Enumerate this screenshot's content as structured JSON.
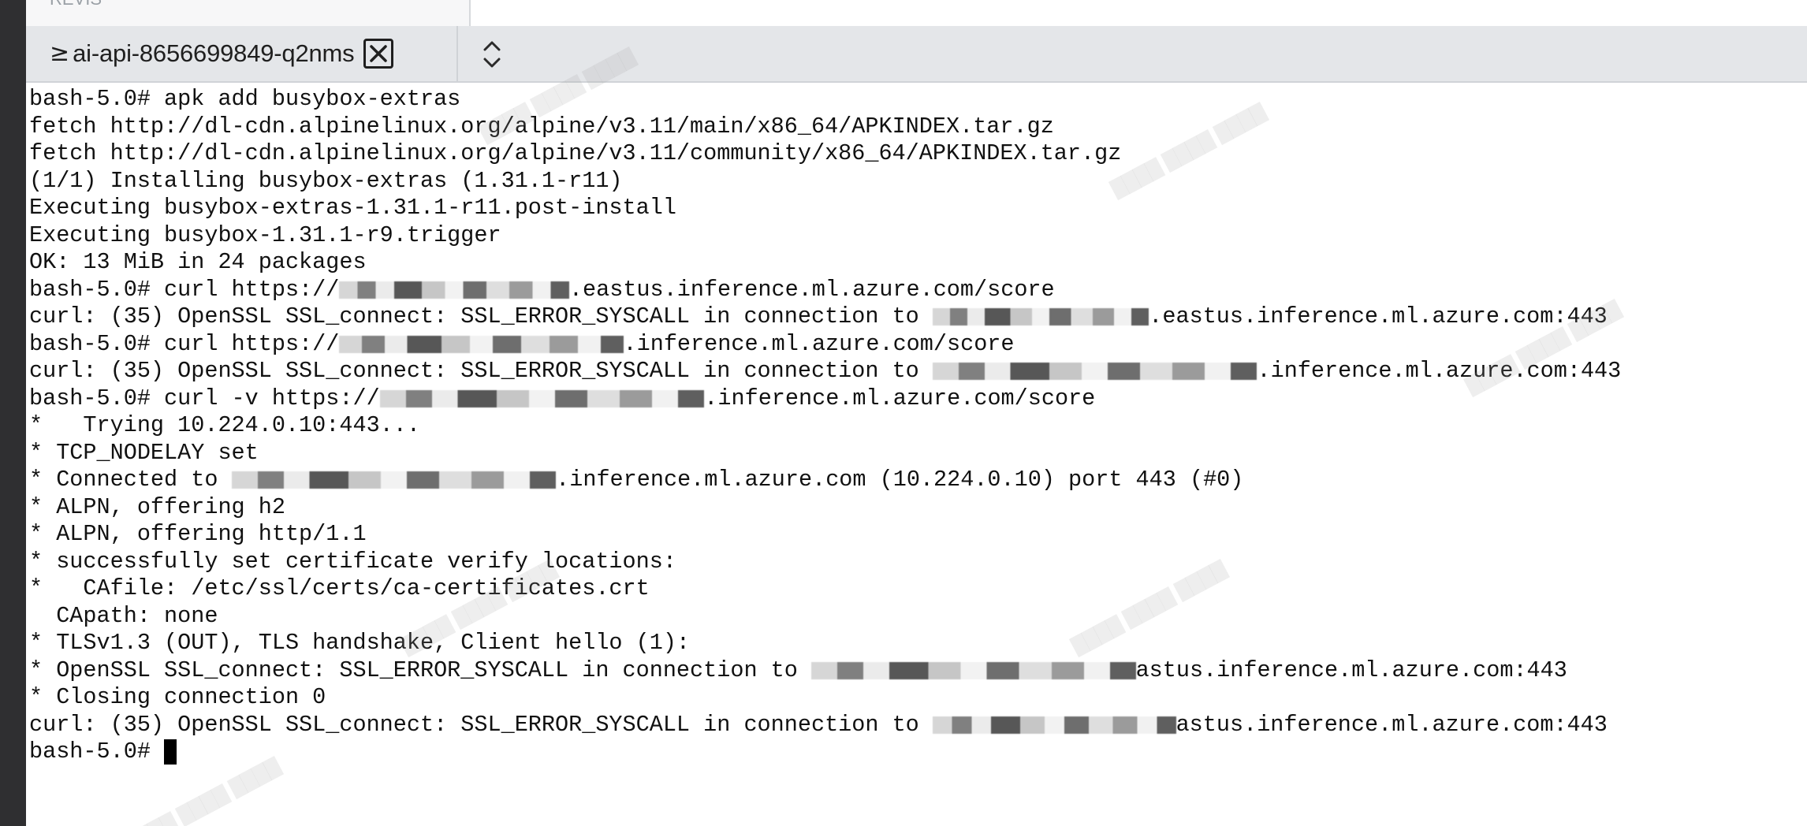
{
  "top_tab": {
    "label": "REVIS"
  },
  "tab": {
    "icon": "terminal-prompt-icon",
    "icon_glyph": "≥",
    "label": "ai-api-8656699849-q2nms"
  },
  "terminal": {
    "lines": [
      {
        "segs": [
          {
            "t": "bash-5.0# apk add busybox-extras"
          }
        ]
      },
      {
        "segs": [
          {
            "t": "fetch http://dl-cdn.alpinelinux.org/alpine/v3.11/main/x86_64/APKINDEX.tar.gz"
          }
        ]
      },
      {
        "segs": [
          {
            "t": "fetch http://dl-cdn.alpinelinux.org/alpine/v3.11/community/x86_64/APKINDEX.tar.gz"
          }
        ]
      },
      {
        "segs": [
          {
            "t": "(1/1) Installing busybox-extras (1.31.1-r11)"
          }
        ]
      },
      {
        "segs": [
          {
            "t": "Executing busybox-extras-1.31.1-r11.post-install"
          }
        ]
      },
      {
        "segs": [
          {
            "t": "Executing busybox-1.31.1-r9.trigger"
          }
        ]
      },
      {
        "segs": [
          {
            "t": "OK: 13 MiB in 24 packages"
          }
        ]
      },
      {
        "segs": [
          {
            "t": "bash-5.0# curl https://"
          },
          {
            "r": 17
          },
          {
            "t": ".eastus.inference.ml.azure.com/score"
          }
        ]
      },
      {
        "segs": [
          {
            "t": "curl: (35) OpenSSL SSL_connect: SSL_ERROR_SYSCALL in connection to "
          },
          {
            "r": 16
          },
          {
            "t": ".eastus.inference.ml.azure.com:443"
          }
        ]
      },
      {
        "segs": [
          {
            "t": "bash-5.0# curl https://"
          },
          {
            "r": 21
          },
          {
            "t": ".inference.ml.azure.com/score"
          }
        ]
      },
      {
        "segs": [
          {
            "t": "curl: (35) OpenSSL SSL_connect: SSL_ERROR_SYSCALL in connection to "
          },
          {
            "r": 24
          },
          {
            "t": ".inference.ml.azure.com:443"
          }
        ]
      },
      {
        "segs": [
          {
            "t": "bash-5.0# curl -v https://"
          },
          {
            "r": 24
          },
          {
            "t": ".inference.ml.azure.com/score"
          }
        ]
      },
      {
        "segs": [
          {
            "t": "*   Trying 10.224.0.10:443..."
          }
        ]
      },
      {
        "segs": [
          {
            "t": "* TCP_NODELAY set"
          }
        ]
      },
      {
        "segs": [
          {
            "t": "* Connected to "
          },
          {
            "r": 24
          },
          {
            "t": ".inference.ml.azure.com (10.224.0.10) port 443 (#0)"
          }
        ]
      },
      {
        "segs": [
          {
            "t": "* ALPN, offering h2"
          }
        ]
      },
      {
        "segs": [
          {
            "t": "* ALPN, offering http/1.1"
          }
        ]
      },
      {
        "segs": [
          {
            "t": "* successfully set certificate verify locations:"
          }
        ]
      },
      {
        "segs": [
          {
            "t": "*   CAfile: /etc/ssl/certs/ca-certificates.crt"
          }
        ]
      },
      {
        "segs": [
          {
            "t": "  CApath: none"
          }
        ]
      },
      {
        "segs": [
          {
            "t": "* TLSv1.3 (OUT), TLS handshake, Client hello (1):"
          }
        ]
      },
      {
        "segs": [
          {
            "t": "* OpenSSL SSL_connect: SSL_ERROR_SYSCALL in connection to "
          },
          {
            "r": 24
          },
          {
            "t": "astus.inference.ml.azure.com:443"
          }
        ]
      },
      {
        "segs": [
          {
            "t": "* Closing connection 0"
          }
        ]
      },
      {
        "segs": [
          {
            "t": "curl: (35) OpenSSL SSL_connect: SSL_ERROR_SYSCALL in connection to "
          },
          {
            "r": 18
          },
          {
            "t": "astus.inference.ml.azure.com:443"
          }
        ]
      },
      {
        "segs": [
          {
            "t": "bash-5.0# "
          },
          {
            "cursor": true
          }
        ]
      }
    ]
  }
}
